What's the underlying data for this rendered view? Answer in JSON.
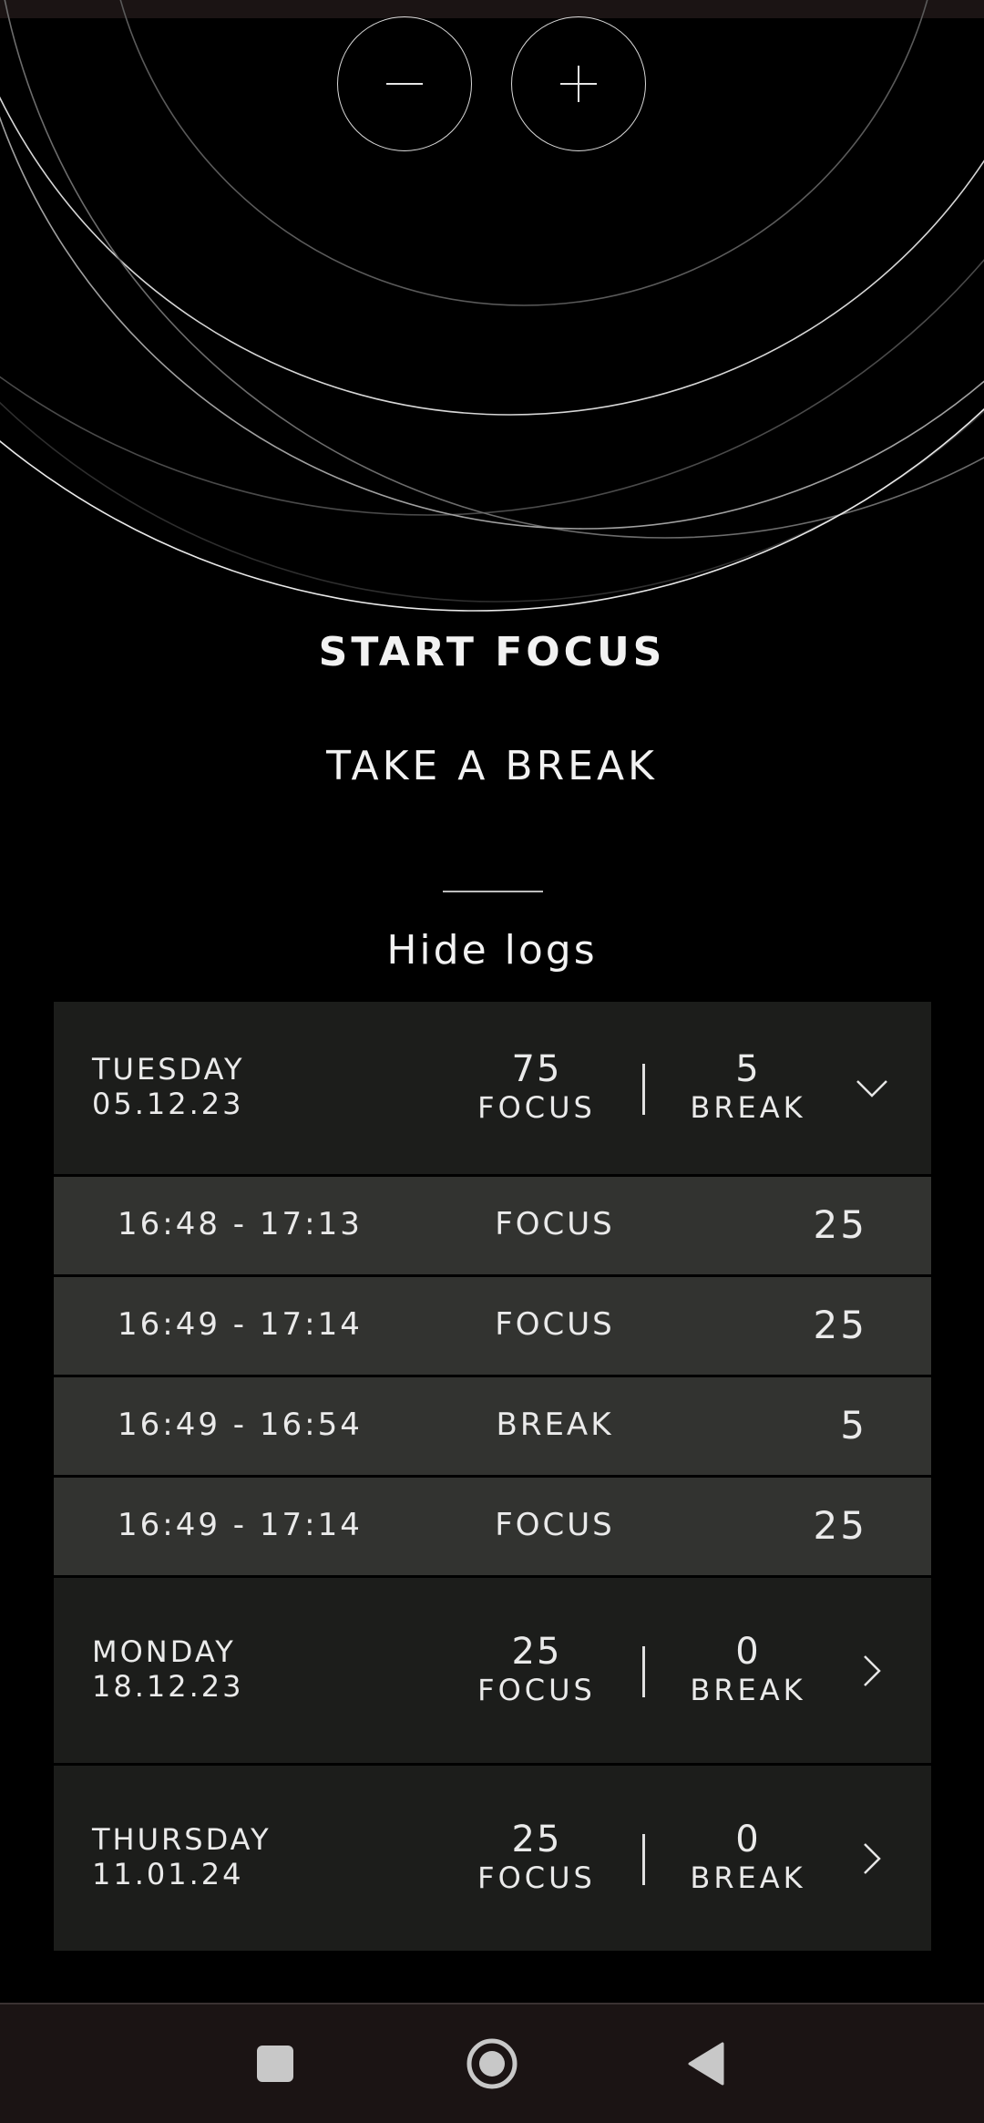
{
  "timer": {
    "decrease_icon": "minus-icon",
    "increase_icon": "plus-icon"
  },
  "actions": {
    "start_focus": "START FOCUS",
    "take_break": "TAKE A BREAK",
    "hide_logs": "Hide logs"
  },
  "logs": [
    {
      "day": "TUESDAY",
      "date": "05.12.23",
      "focus": "75",
      "focus_label": "FOCUS",
      "break": "5",
      "break_label": "BREAK",
      "expanded": true,
      "entries": [
        {
          "time": "16:48 - 17:13",
          "type": "FOCUS",
          "duration": "25"
        },
        {
          "time": "16:49 - 17:14",
          "type": "FOCUS",
          "duration": "25"
        },
        {
          "time": "16:49 - 16:54",
          "type": "BREAK",
          "duration": "5"
        },
        {
          "time": "16:49 - 17:14",
          "type": "FOCUS",
          "duration": "25"
        }
      ]
    },
    {
      "day": "MONDAY",
      "date": "18.12.23",
      "focus": "25",
      "focus_label": "FOCUS",
      "break": "0",
      "break_label": "BREAK",
      "expanded": false
    },
    {
      "day": "THURSDAY",
      "date": "11.01.24",
      "focus": "25",
      "focus_label": "FOCUS",
      "break": "0",
      "break_label": "BREAK",
      "expanded": false
    }
  ],
  "navbar": {
    "recents_icon": "square-icon",
    "home_icon": "circle-icon",
    "back_icon": "triangle-back-icon"
  },
  "colors": {
    "background": "#000000",
    "day_row": "#1c1d1b",
    "entry_row": "#323330",
    "navbar": "#1b1414"
  }
}
